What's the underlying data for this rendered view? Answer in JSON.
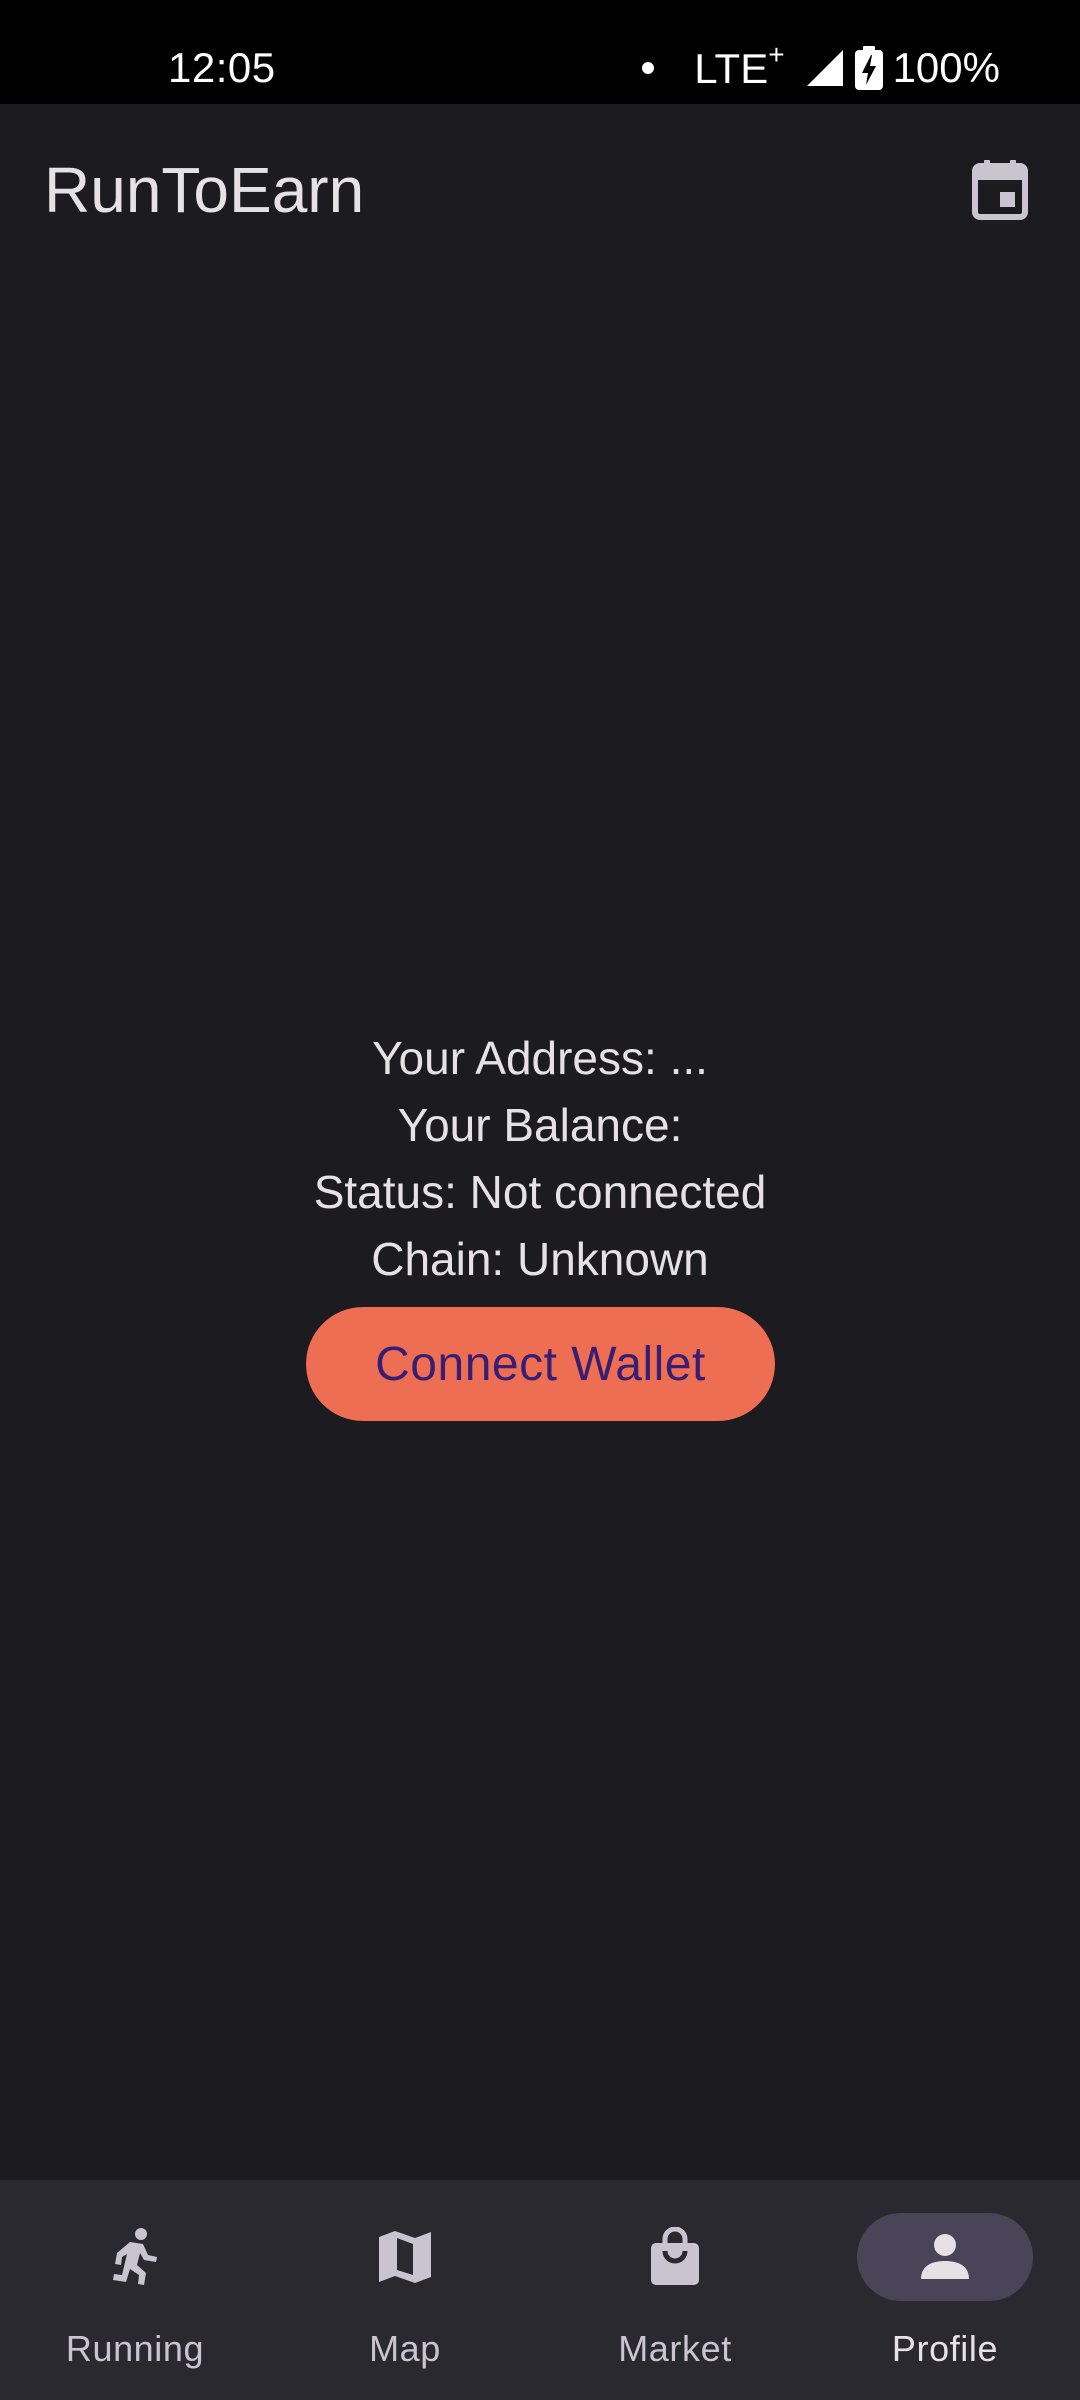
{
  "status_bar": {
    "time": "12:05",
    "network": "LTE",
    "network_suffix": "+",
    "battery": "100%",
    "icons": [
      "notification-dot-icon",
      "signal-icon",
      "battery-charging-icon"
    ]
  },
  "app_bar": {
    "title": "RunToEarn",
    "action_icon": "calendar-icon"
  },
  "wallet": {
    "address_line": "Your Address: ...",
    "balance_line": "Your Balance:",
    "status_line": "Status: Not connected",
    "chain_line": "Chain: Unknown",
    "connect_label": "Connect Wallet"
  },
  "bottom_nav": {
    "items": [
      {
        "label": "Running",
        "icon": "running-icon",
        "active": false
      },
      {
        "label": "Map",
        "icon": "map-icon",
        "active": false
      },
      {
        "label": "Market",
        "icon": "shopping-bag-icon",
        "active": false
      },
      {
        "label": "Profile",
        "icon": "person-icon",
        "active": true
      }
    ]
  },
  "colors": {
    "background": "#1c1b1f",
    "status_bar": "#000000",
    "nav_background": "#2b2930",
    "nav_active_indicator": "#4a4458",
    "button_background": "#ee6e53",
    "button_text": "#371e73",
    "text_primary": "#e6e1e5",
    "text_secondary": "#cac4d0"
  }
}
